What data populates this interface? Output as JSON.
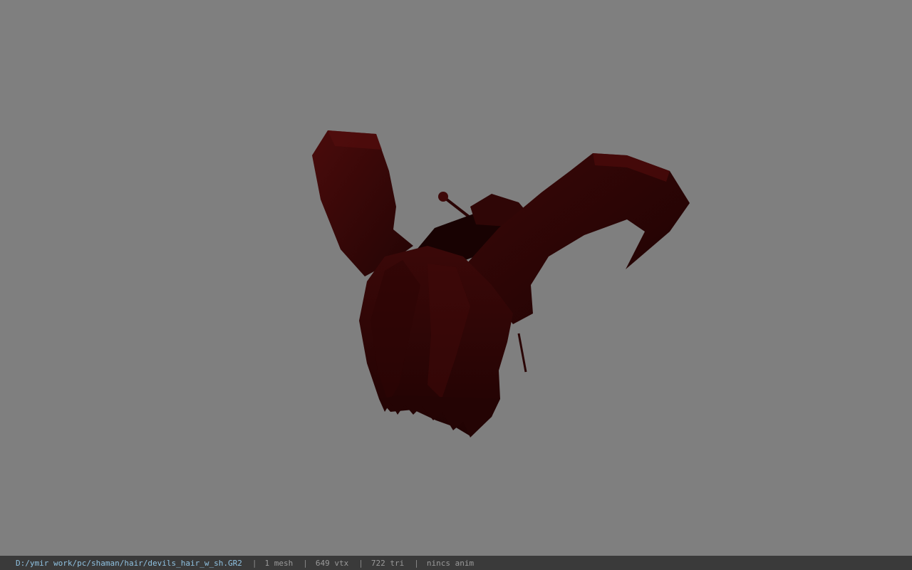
{
  "viewer": {
    "background_color": "#7f7f7f",
    "model_color": "#3a0808",
    "model": {
      "name": "devils_hair_w_sh",
      "icon": "horned-hair-model-icon"
    }
  },
  "status_bar": {
    "file_path": "D:/ymir work/pc/shaman/hair/devils_hair_w_sh.GR2",
    "separator": "|",
    "mesh_count": "1 mesh",
    "vertex_count": "649 vtx",
    "triangle_count": "722 tri",
    "animation": "nincs anim",
    "path_color": "#8fc1e0",
    "text_color": "#9a9a9a"
  }
}
